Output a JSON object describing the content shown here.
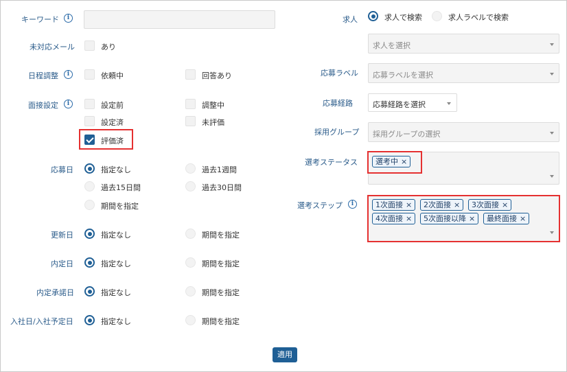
{
  "left": {
    "keyword": {
      "label": "キーワード",
      "value": "",
      "placeholder": ""
    },
    "unhandled_mail": {
      "label": "未対応メール",
      "option": "あり"
    },
    "schedule": {
      "label": "日程調整",
      "options": [
        "依頼中",
        "回答あり"
      ]
    },
    "interview": {
      "label": "面接設定",
      "options": [
        "設定前",
        "調整中",
        "設定済",
        "未評価",
        "評価済"
      ]
    },
    "applied_date": {
      "label": "応募日",
      "options": [
        "指定なし",
        "過去1週間",
        "過去15日間",
        "過去30日間",
        "期間を指定"
      ]
    },
    "updated_date": {
      "label": "更新日",
      "options": [
        "指定なし",
        "期間を指定"
      ]
    },
    "offer_date": {
      "label": "内定日",
      "options": [
        "指定なし",
        "期間を指定"
      ]
    },
    "offer_accept_date": {
      "label": "内定承諾日",
      "options": [
        "指定なし",
        "期間を指定"
      ]
    },
    "join_date": {
      "label": "入社日/入社予定日",
      "options": [
        "指定なし",
        "期間を指定"
      ]
    }
  },
  "right": {
    "job": {
      "label": "求人",
      "options": [
        "求人で検索",
        "求人ラベルで検索"
      ],
      "placeholder": "求人を選択"
    },
    "apply_label": {
      "label": "応募ラベル",
      "placeholder": "応募ラベルを選択"
    },
    "apply_route": {
      "label": "応募経路",
      "placeholder": "応募経路を選択"
    },
    "hiring_group": {
      "label": "採用グループ",
      "placeholder": "採用グループの選択"
    },
    "selection_status": {
      "label": "選考ステータス",
      "tags": [
        "選考中"
      ]
    },
    "selection_step": {
      "label": "選考ステップ",
      "tags": [
        "1次面接",
        "2次面接",
        "3次面接",
        "4次面接",
        "5次面接以降",
        "最終面接"
      ]
    }
  },
  "apply_button": "適用",
  "icons": {
    "info": "i",
    "remove": "×"
  },
  "colors": {
    "accent": "#1f5f95",
    "label": "#2a5b8a",
    "highlight": "#e53030"
  }
}
